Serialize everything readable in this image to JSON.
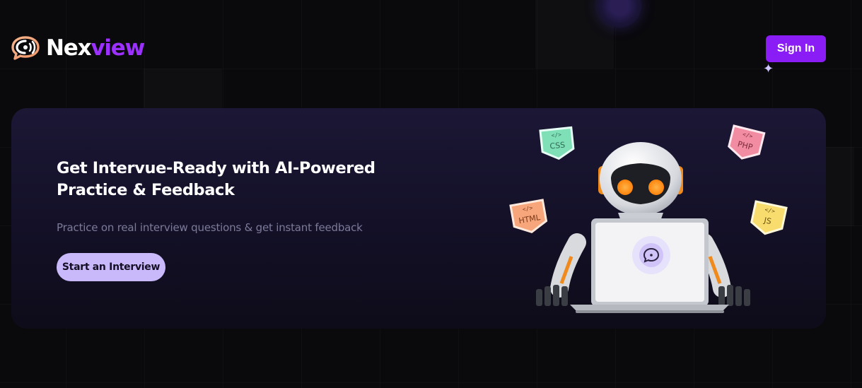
{
  "header": {
    "brand_part1": "Nex",
    "brand_part2": "view",
    "signin_label": "Sign In"
  },
  "hero": {
    "title_line1": "Get Intervue-Ready with AI-Powered",
    "title_line2": "Practice & Feedback",
    "subtitle": "Practice on real interview questions & get instant feedback",
    "cta_label": "Start an Interview"
  },
  "illustration": {
    "badges": [
      "CSS",
      "PHP",
      "HTML",
      "JS"
    ]
  },
  "colors": {
    "background": "#0a090c",
    "brand_purple": "#8a1cf6",
    "brand_text_accent": "#9b30ff",
    "cta_bg": "#c9b9fb"
  },
  "icons": {
    "logo": "chat-bubble-icon",
    "sparkle": "sparkle-icon"
  }
}
